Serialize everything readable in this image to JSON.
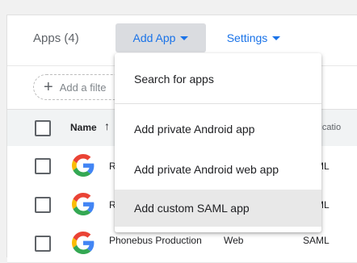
{
  "header": {
    "apps_title": "Apps (4)",
    "add_app_label": "Add App",
    "settings_label": "Settings"
  },
  "filter": {
    "placeholder": "Add a filte"
  },
  "table": {
    "col_name": "Name",
    "col_auth": "nenticatio",
    "rows": [
      {
        "name": "R",
        "type": "",
        "auth": "SAML"
      },
      {
        "name": "R",
        "type": "",
        "auth": "SAML"
      },
      {
        "name": "Phonebus Production",
        "type": "Web",
        "auth": "SAML"
      }
    ]
  },
  "menu": {
    "items": [
      {
        "label": "Search for apps"
      },
      {
        "label": "Add private Android app"
      },
      {
        "label": "Add private Android web app"
      },
      {
        "label": "Add custom SAML app"
      }
    ],
    "active_index": 3
  },
  "colors": {
    "accent": "#1a73e8",
    "active_button_bg": "#dadce0",
    "menu_hover_bg": "#e8e8e8"
  },
  "icons": [
    "plus-icon",
    "caret-down-icon",
    "sort-up-icon",
    "google-g-icon",
    "checkbox-icon"
  ]
}
